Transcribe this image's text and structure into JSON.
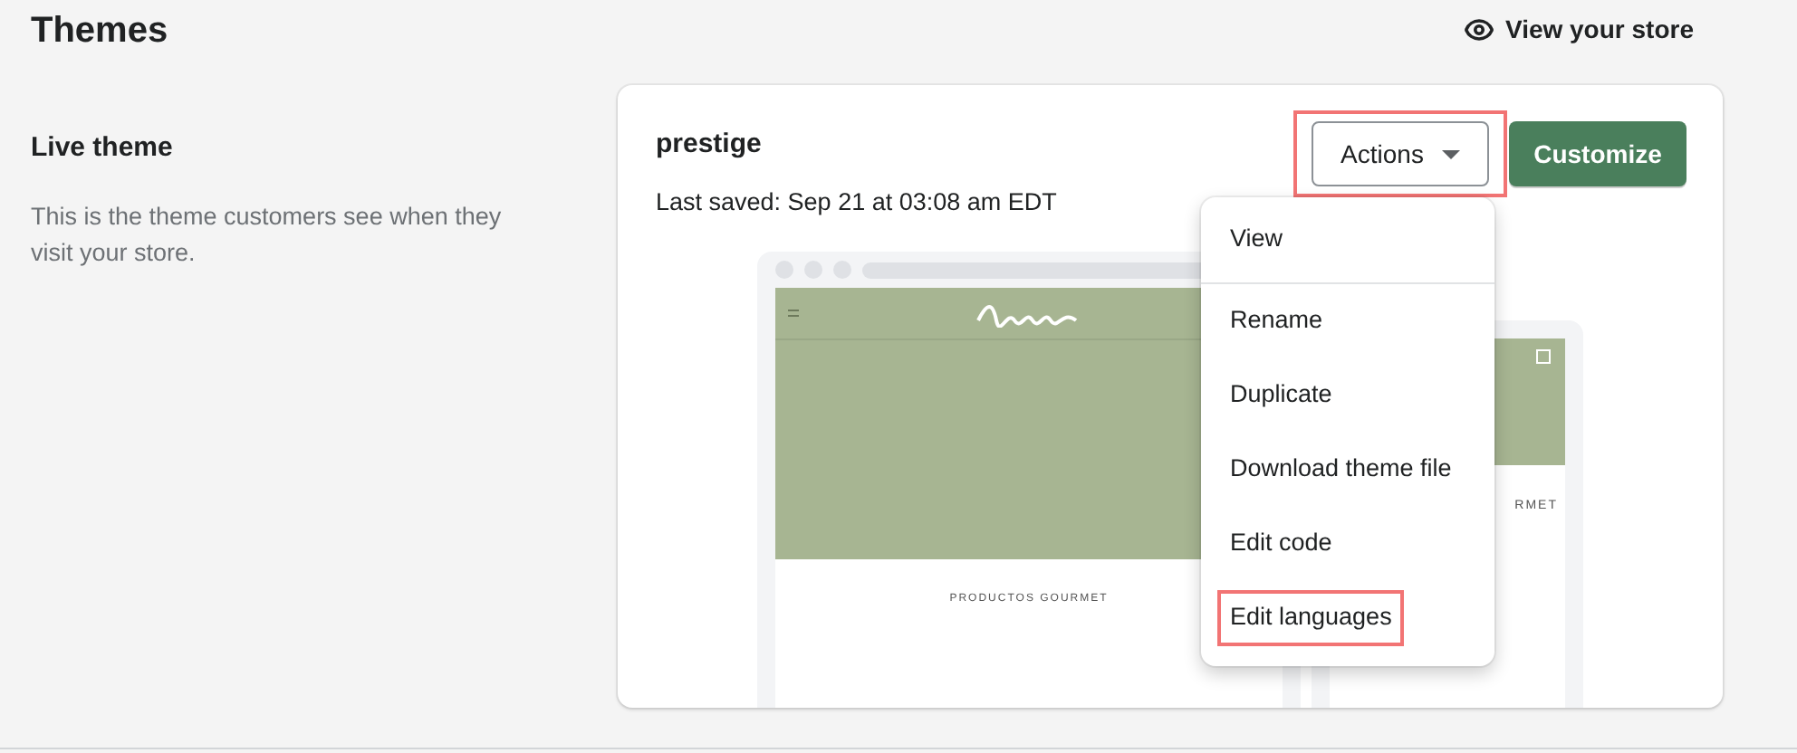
{
  "page": {
    "title": "Themes",
    "view_store_link": "View your store"
  },
  "section": {
    "title": "Live theme",
    "description": "This is the theme customers see when they visit your store."
  },
  "theme": {
    "name": "prestige",
    "last_saved": "Last saved: Sep 21 at 03:08 am EDT"
  },
  "actions_button": {
    "label": "Actions",
    "expanded": true,
    "highlighted": true
  },
  "customize_button": {
    "label": "Customize"
  },
  "actions_menu": [
    {
      "label": "View",
      "highlighted": false
    },
    {
      "label": "Rename",
      "highlighted": false
    },
    {
      "label": "Duplicate",
      "highlighted": false
    },
    {
      "label": "Download theme file",
      "highlighted": false
    },
    {
      "label": "Edit code",
      "highlighted": false
    },
    {
      "label": "Edit languages",
      "highlighted": true
    }
  ],
  "preview": {
    "desktop_heading": "PRODUCTOS GOURMET",
    "mobile_heading": "RMET"
  }
}
